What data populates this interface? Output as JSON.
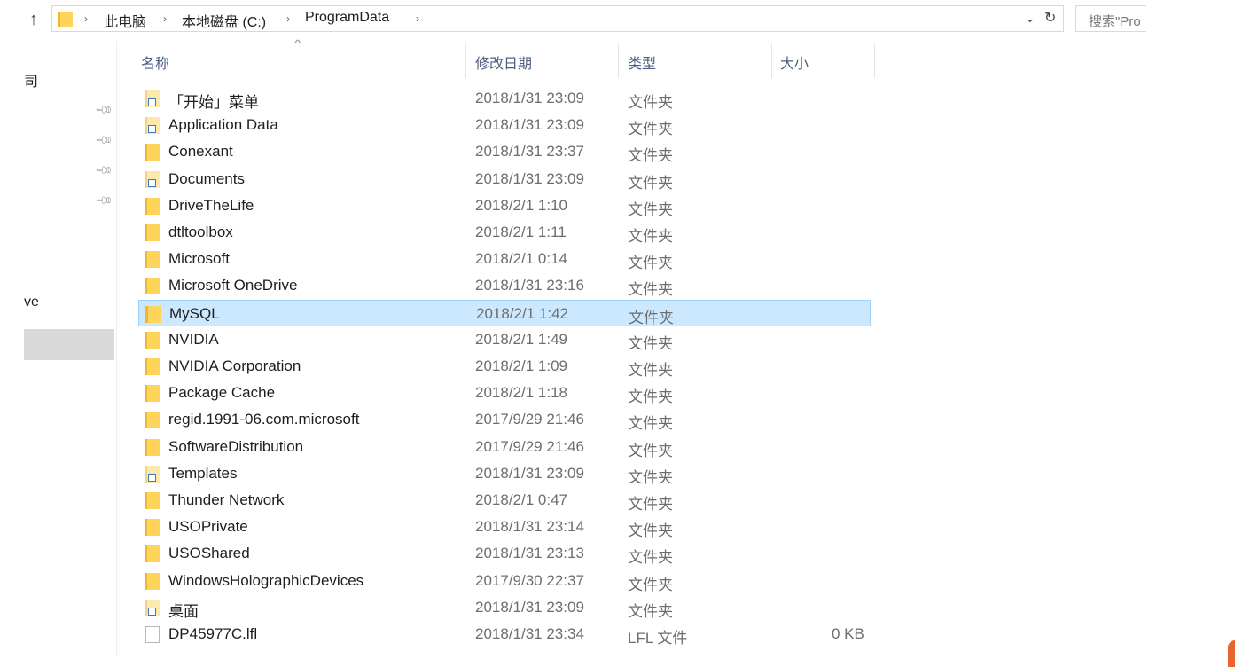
{
  "window": {
    "address": {
      "crumbs": [
        "此电脑",
        "本地磁盘 (C:)",
        "ProgramData"
      ],
      "separator": "›",
      "search_placeholder": "搜索\"Pro"
    },
    "nav_fragments": [
      "司",
      "ve"
    ]
  },
  "columns": [
    "名称",
    "修改日期",
    "类型",
    "大小"
  ],
  "files": [
    {
      "name": "「开始」菜单",
      "date": "2018/1/31 23:09",
      "type": "文件夹",
      "size": "",
      "icon": "shortcut-folder-icon"
    },
    {
      "name": "Application Data",
      "date": "2018/1/31 23:09",
      "type": "文件夹",
      "size": "",
      "icon": "shortcut-folder-icon"
    },
    {
      "name": "Conexant",
      "date": "2018/1/31 23:37",
      "type": "文件夹",
      "size": "",
      "icon": "folder-icon"
    },
    {
      "name": "Documents",
      "date": "2018/1/31 23:09",
      "type": "文件夹",
      "size": "",
      "icon": "shortcut-folder-icon"
    },
    {
      "name": "DriveTheLife",
      "date": "2018/2/1 1:10",
      "type": "文件夹",
      "size": "",
      "icon": "folder-icon"
    },
    {
      "name": "dtltoolbox",
      "date": "2018/2/1 1:11",
      "type": "文件夹",
      "size": "",
      "icon": "folder-icon"
    },
    {
      "name": "Microsoft",
      "date": "2018/2/1 0:14",
      "type": "文件夹",
      "size": "",
      "icon": "folder-icon"
    },
    {
      "name": "Microsoft OneDrive",
      "date": "2018/1/31 23:16",
      "type": "文件夹",
      "size": "",
      "icon": "folder-icon"
    },
    {
      "name": "MySQL",
      "date": "2018/2/1 1:42",
      "type": "文件夹",
      "size": "",
      "icon": "folder-icon",
      "selected": true
    },
    {
      "name": "NVIDIA",
      "date": "2018/2/1 1:49",
      "type": "文件夹",
      "size": "",
      "icon": "folder-icon"
    },
    {
      "name": "NVIDIA Corporation",
      "date": "2018/2/1 1:09",
      "type": "文件夹",
      "size": "",
      "icon": "folder-icon"
    },
    {
      "name": "Package Cache",
      "date": "2018/2/1 1:18",
      "type": "文件夹",
      "size": "",
      "icon": "folder-icon"
    },
    {
      "name": "regid.1991-06.com.microsoft",
      "date": "2017/9/29 21:46",
      "type": "文件夹",
      "size": "",
      "icon": "folder-icon"
    },
    {
      "name": "SoftwareDistribution",
      "date": "2017/9/29 21:46",
      "type": "文件夹",
      "size": "",
      "icon": "folder-icon"
    },
    {
      "name": "Templates",
      "date": "2018/1/31 23:09",
      "type": "文件夹",
      "size": "",
      "icon": "shortcut-folder-icon"
    },
    {
      "name": "Thunder Network",
      "date": "2018/2/1 0:47",
      "type": "文件夹",
      "size": "",
      "icon": "folder-icon"
    },
    {
      "name": "USOPrivate",
      "date": "2018/1/31 23:14",
      "type": "文件夹",
      "size": "",
      "icon": "folder-icon"
    },
    {
      "name": "USOShared",
      "date": "2018/1/31 23:13",
      "type": "文件夹",
      "size": "",
      "icon": "folder-icon"
    },
    {
      "name": "WindowsHolographicDevices",
      "date": "2017/9/30 22:37",
      "type": "文件夹",
      "size": "",
      "icon": "folder-icon"
    },
    {
      "name": "桌面",
      "date": "2018/1/31 23:09",
      "type": "文件夹",
      "size": "",
      "icon": "shortcut-folder-icon"
    },
    {
      "name": "DP45977C.lfl",
      "date": "2018/1/31 23:34",
      "type": "LFL 文件",
      "size": "0 KB",
      "icon": "file-icon"
    }
  ],
  "colors": {
    "selection": "#cce8ff",
    "selection_border": "#99d1ff",
    "header_text": "#4d6082",
    "folder": "#ffd45a"
  }
}
